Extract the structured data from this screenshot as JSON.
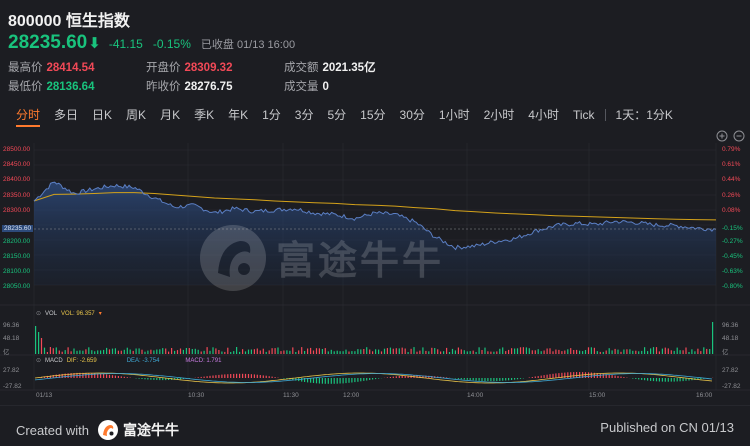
{
  "header": {
    "title": "800000 恒生指数",
    "price": "28235.60",
    "change": "-41.15",
    "change_pct": "-0.15%",
    "status": "已收盘 01/13 16:00",
    "stats": {
      "high_label": "最高价",
      "high": "28414.54",
      "low_label": "最低价",
      "low": "28136.64",
      "open_label": "开盘价",
      "open": "28309.32",
      "prev_label": "昨收价",
      "prev": "28276.75",
      "turnover_label": "成交额",
      "turnover": "2021.35亿",
      "volume_label": "成交量",
      "volume": "0"
    }
  },
  "tabs": [
    "分时",
    "多日",
    "日K",
    "周K",
    "月K",
    "季K",
    "年K",
    "1分",
    "3分",
    "5分",
    "15分",
    "30分",
    "1小时",
    "2小时",
    "4小时",
    "Tick",
    "1天：1分K"
  ],
  "active_tab": "分时",
  "chart": {
    "left_ticks": [
      "28500.00",
      "28450.00",
      "28400.00",
      "28350.00",
      "28300.00",
      "28235.60",
      "28200.00",
      "28150.00",
      "28100.00",
      "28050.00"
    ],
    "right_ticks": [
      "0.79%",
      "0.61%",
      "0.44%",
      "0.26%",
      "0.08%",
      "-0.15%",
      "-0.27%",
      "-0.45%",
      "-0.63%",
      "-0.80%"
    ],
    "vol_legend": {
      "name": "VOL",
      "value_label": "VOL: 96.357"
    },
    "vol_ticks": [
      "96.36",
      "48.18",
      "亿"
    ],
    "vol_right_ticks": [
      "96.36",
      "48.18",
      "亿"
    ],
    "macd_legend": {
      "name": "MACD",
      "dif": "DIF: -2.659",
      "dea": "DEA: -3.754",
      "macd": "MACD: 1.791"
    },
    "macd_ticks": [
      "27.82",
      "-27.82"
    ],
    "time_labels": [
      "01/13",
      "10:30",
      "11:30",
      "12:00",
      "14:00",
      "15:00",
      "16:00"
    ],
    "colors": {
      "price_line": "#5b7fc4",
      "avg_line": "#d4a21a",
      "up": "#f24957",
      "down": "#19c37d",
      "accent": "#ff7a2e"
    }
  },
  "chart_data": {
    "type": "line",
    "title": "800000 恒生指数",
    "x": [
      "09:30",
      "09:40",
      "09:50",
      "10:00",
      "10:10",
      "10:20",
      "10:30",
      "10:40",
      "10:50",
      "11:00",
      "11:10",
      "11:20",
      "11:30",
      "11:40",
      "11:50",
      "12:00",
      "13:00",
      "13:10",
      "13:20",
      "13:30",
      "13:40",
      "13:50",
      "14:00",
      "14:10",
      "14:20",
      "14:30",
      "14:40",
      "14:50",
      "15:00",
      "15:10",
      "15:20",
      "15:30",
      "15:40",
      "15:50",
      "16:00"
    ],
    "series": [
      {
        "values": [
          28330,
          28395,
          28355,
          28370,
          28382,
          28375,
          28340,
          28310,
          28315,
          28290,
          28305,
          28295,
          28300,
          28305,
          28290,
          28285,
          28272,
          28290,
          28285,
          28260,
          28210,
          28175,
          28180,
          28195,
          28205,
          28230,
          28248,
          28255,
          28252,
          28262,
          28258,
          28250,
          28248,
          28240,
          28235.6
        ]
      },
      {
        "values": [
          28330,
          28352,
          28353,
          28355,
          28358,
          28358,
          28355,
          28350,
          28345,
          28340,
          28337,
          28334,
          28330,
          28327,
          28324,
          28322,
          28318,
          28316,
          28313,
          28308,
          28304,
          28298,
          28294,
          28290,
          28287,
          28284,
          28281,
          28279,
          28277,
          28275,
          28273,
          28271,
          28269,
          28268,
          28267
        ]
      }
    ],
    "ylim": [
      28050,
      28500
    ]
  }
}
